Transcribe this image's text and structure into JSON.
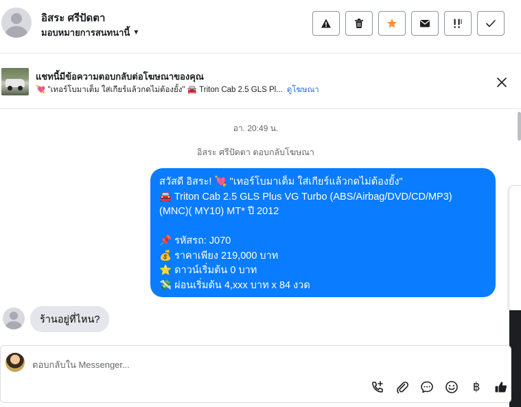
{
  "header": {
    "contact_name": "อิสระ ศรีปัดตา",
    "assign_label": "มอบหมายการสนทนานี้",
    "toolbar": [
      "spam-report",
      "delete",
      "star",
      "mark-unread",
      "follow-up",
      "done"
    ]
  },
  "ad_banner": {
    "title": "แชทนี้มีข้อความตอบกลับต่อโฆษณาของคุณ",
    "snippet": "💘 \"เทอร์โบมาเต็ม ใส่เกียร์แล้วกดไม่ต้องยั้ง\" 🚘 Triton Cab 2.5 GLS Pl...",
    "view_ad_link": "ดูโฆษณา"
  },
  "conversation": {
    "timestamp": "อา. 20:49 น.",
    "replied_notice": "อิสระ ศรีปัดตา ตอบกลับโฆษณา",
    "outgoing_lines": [
      "สวัสดี อิสระ! 💘 \"เทอร์โบมาเต็ม ใส่เกียร์แล้วกดไม่ต้องยั้ง\"",
      "🚘 Triton Cab 2.5 GLS Plus VG Turbo (ABS/Airbag/DVD/CD/MP3)",
      "(MNC)( MY10) MT* ปี 2012",
      "",
      "📌 รหัสรถ: J070",
      "💰 ราคาเพียง 219,000 บาท",
      "⭐ ดาวน์เริ่มต้น 0 บาท",
      "💸 ผ่อนเริ่มต้น 4,xxx บาท x 84 งวด"
    ],
    "incoming_message": "ร้านอยู่ที่ไหน?"
  },
  "composer": {
    "placeholder": "ตอบกลับใน Messenger...",
    "currency_symbol": "฿"
  },
  "colors": {
    "outgoing_bubble": "#0a7cff",
    "incoming_bubble": "#e4e6eb",
    "star_accent": "#f7923a",
    "link": "#216fdb"
  }
}
